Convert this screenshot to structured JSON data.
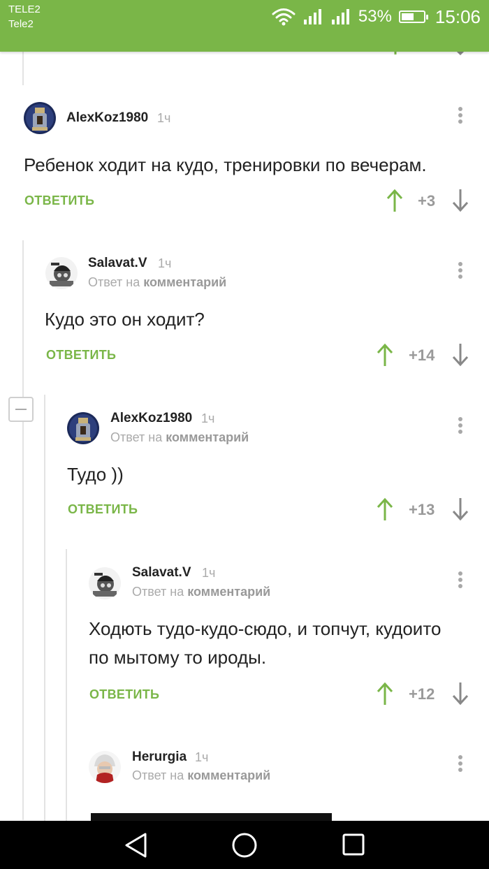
{
  "status_bar": {
    "carrier_top": "TELE2",
    "carrier_bottom": "Tele2",
    "battery": "53%",
    "time": "15:06",
    "battery_level": 0.53
  },
  "comments": [
    {
      "author": "AlexKoz1980",
      "time": "1ч",
      "reply_to": null,
      "text": "Ребенок ходит на кудо, тренировки по вечерам.",
      "reply_label": "ОТВЕТИТЬ",
      "score": "+3"
    },
    {
      "author": "Salavat.V",
      "time": "1ч",
      "reply_to": {
        "prefix": "Ответ на",
        "link": "комментарий"
      },
      "text": "Кудо это он ходит?",
      "reply_label": "ОТВЕТИТЬ",
      "score": "+14"
    },
    {
      "author": "AlexKoz1980",
      "time": "1ч",
      "reply_to": {
        "prefix": "Ответ на",
        "link": "комментарий"
      },
      "text": "Тудо ))",
      "reply_label": "ОТВЕТИТЬ",
      "score": "+13"
    },
    {
      "author": "Salavat.V",
      "time": "1ч",
      "reply_to": {
        "prefix": "Ответ на",
        "link": "комментарий"
      },
      "text_line1": "Ходють тудо-кудо-сюдо, и топчут, кудоито",
      "text_line2": "по мытому то ироды.",
      "reply_label": "ОТВЕТИТЬ",
      "score": "+12"
    },
    {
      "author": "Herurgia",
      "time": "1ч",
      "reply_to": {
        "prefix": "Ответ на",
        "link": "комментарий"
      }
    }
  ],
  "colors": {
    "accent": "#7ab648",
    "upvote": "#7ab648",
    "downvote": "#888888"
  },
  "icons": {
    "menu": "more-vertical-icon",
    "upvote": "arrow-up-icon",
    "downvote": "arrow-down-icon",
    "collapse": "minus-icon",
    "nav_back": "triangle-back-icon",
    "nav_home": "circle-home-icon",
    "nav_recent": "square-recents-icon"
  }
}
